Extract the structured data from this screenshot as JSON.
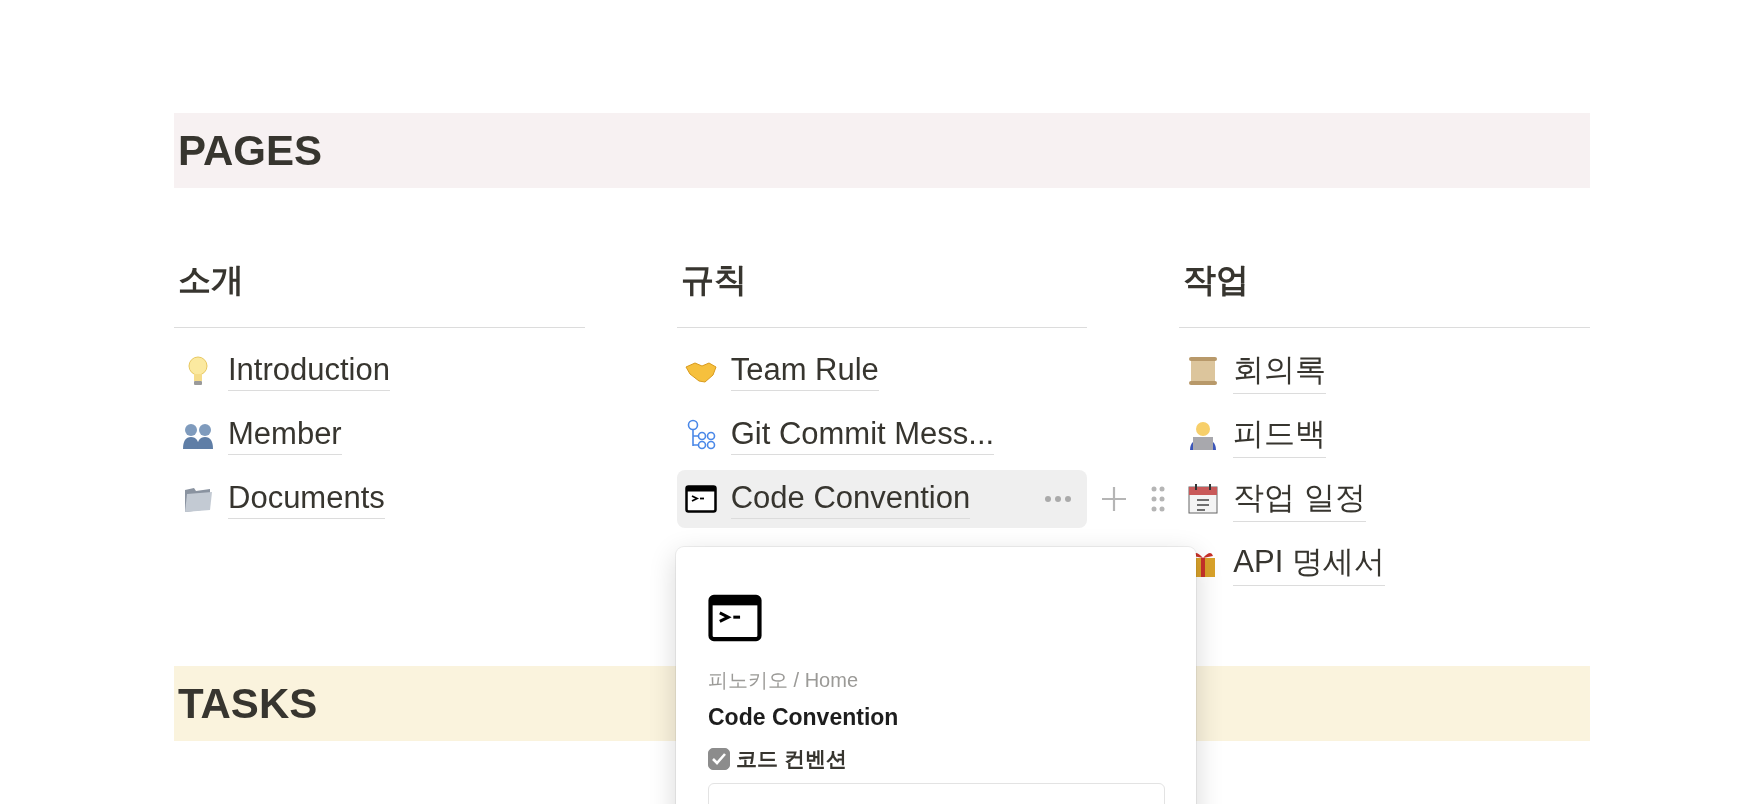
{
  "sections": [
    {
      "title": "PAGES",
      "color": "#f7f1f2",
      "columns": [
        {
          "heading": "소개",
          "items": [
            {
              "title": "Introduction",
              "kind": "bulb",
              "hovered": false
            },
            {
              "title": "Member",
              "kind": "people",
              "hovered": false
            },
            {
              "title": "Documents",
              "kind": "folder",
              "hovered": false
            }
          ]
        },
        {
          "heading": "규칙",
          "items": [
            {
              "title": "Team Rule",
              "kind": "handshake",
              "hovered": false
            },
            {
              "title": "Git Commit Mess...",
              "kind": "flow",
              "hovered": false
            },
            {
              "title": "Code Convention",
              "kind": "terminal",
              "hovered": true
            }
          ]
        },
        {
          "heading": "작업",
          "items": [
            {
              "title": "회의록",
              "kind": "scroll",
              "hovered": false
            },
            {
              "title": "피드백",
              "kind": "worker",
              "hovered": false
            },
            {
              "title": "작업 일정",
              "kind": "calendar",
              "hovered": false
            },
            {
              "title": "API 명세서",
              "kind": "gift",
              "hovered": false
            }
          ]
        }
      ]
    },
    {
      "title": "TASKS",
      "color": "#faf3dd"
    }
  ],
  "preview": {
    "kind": "terminal",
    "breadcrumb": "피노키오 / Home",
    "title": "Code Convention",
    "property": {
      "label": "코드 컨벤션",
      "checked": true
    }
  }
}
